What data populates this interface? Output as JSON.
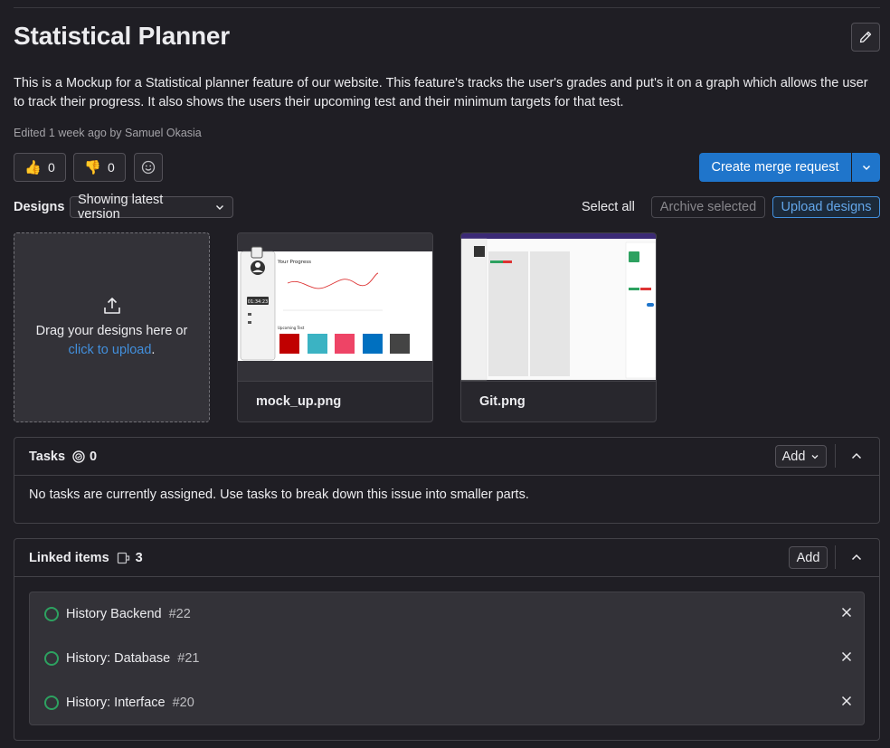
{
  "issue": {
    "title": "Statistical Planner",
    "description": "This is a Mockup for a Statistical planner feature of our website. This feature's tracks the user's grades and put's it on a graph which allows the user to track their progress. It also shows the users their upcoming test and their minimum targets for that test.",
    "edited": "Edited 1 week ago by Samuel Okasia"
  },
  "reactions": {
    "thumbs_up_count": "0",
    "thumbs_down_count": "0"
  },
  "actions": {
    "merge_label": "Create merge request"
  },
  "designs": {
    "label": "Designs",
    "version": "Showing latest version",
    "select_all": "Select all",
    "archive": "Archive selected",
    "upload": "Upload designs",
    "drop_text": "Drag your designs here or",
    "drop_link": "click to upload",
    "drop_period": ".",
    "files": [
      {
        "name": "mock_up.png"
      },
      {
        "name": "Git.png"
      }
    ],
    "mockup_preview": {
      "heading": "Your Progress",
      "timer": "01:34:23",
      "section": "Upcoming Test"
    }
  },
  "tasks": {
    "title": "Tasks",
    "count": "0",
    "add": "Add",
    "empty": "No tasks are currently assigned. Use tasks to break down this issue into smaller parts."
  },
  "linked": {
    "title": "Linked items",
    "count": "3",
    "add": "Add",
    "items": [
      {
        "title": "History Backend",
        "ref": "#22"
      },
      {
        "title": "History: Database",
        "ref": "#21"
      },
      {
        "title": "History: Interface",
        "ref": "#20"
      }
    ]
  },
  "colors": {
    "accent": "#1f75cb",
    "link": "#428fdc",
    "open_status": "#2da160",
    "background": "#1f1e24"
  }
}
